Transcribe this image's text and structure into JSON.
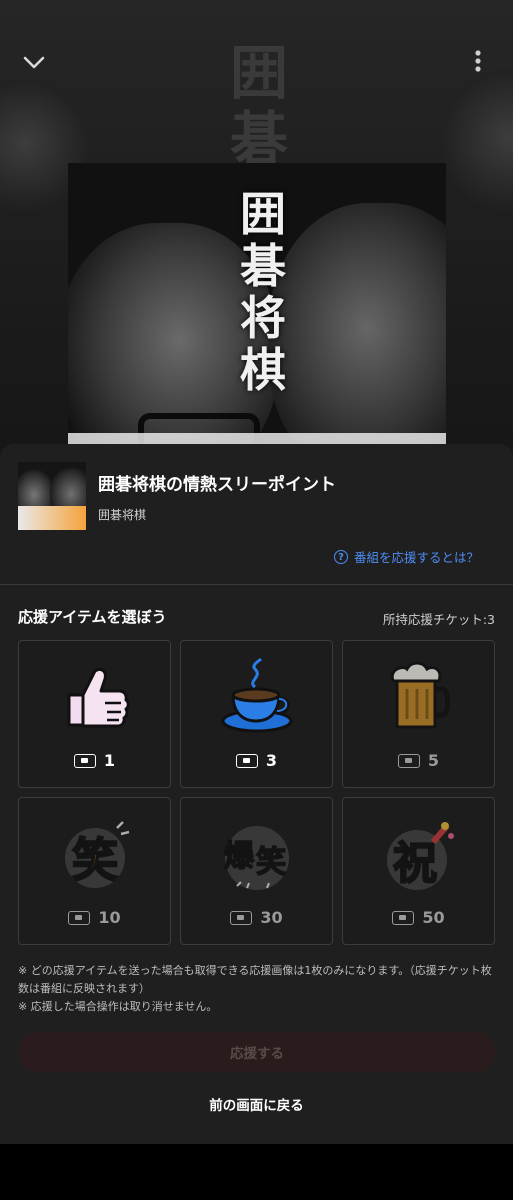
{
  "header": {
    "collapse_icon": "chevron-down-icon",
    "more_icon": "more-vertical-icon"
  },
  "cover": {
    "title_vertical": [
      "囲",
      "碁",
      "将",
      "棋"
    ]
  },
  "background": {
    "kanji": [
      "囲",
      "碁"
    ]
  },
  "program": {
    "title": "囲碁将棋の情熱スリーポイント",
    "channel": "囲碁将棋",
    "help_link": "番組を応援するとは？"
  },
  "support": {
    "section_title": "応援アイテムを選ぼう",
    "tickets_owned": "所持応援チケット:3",
    "items": [
      {
        "name": "thumbs-up",
        "cost": "1",
        "enabled": true
      },
      {
        "name": "coffee",
        "cost": "3",
        "enabled": true
      },
      {
        "name": "beer",
        "cost": "5",
        "enabled": false
      },
      {
        "name": "laugh",
        "cost": "10",
        "enabled": false
      },
      {
        "name": "big-laugh",
        "cost": "30",
        "enabled": false
      },
      {
        "name": "celebrate",
        "cost": "50",
        "enabled": false
      }
    ],
    "item_text": {
      "laugh": "笑",
      "big_laugh_1": "爆",
      "big_laugh_2": "笑",
      "celebrate": "祝"
    },
    "note1": "※ どの応援アイテムを送った場合も取得できる応援画像は1枚のみになります。（応援チケット枚数は番組に反映されます）",
    "note2": "※ 応援した場合操作は取り消せません。",
    "cheer_button": "応援する",
    "back_button": "前の画面に戻る"
  },
  "colors": {
    "link": "#4f8df5",
    "sheet_bg": "#1f1f1f",
    "disabled_button_bg": "#2a1c1c"
  }
}
